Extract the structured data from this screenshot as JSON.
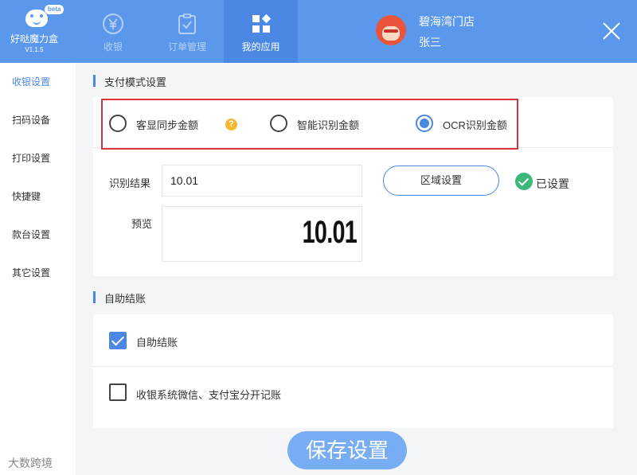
{
  "app": {
    "badge": "beta",
    "name": "好哒魔力盒",
    "version": "V1.1.5"
  },
  "nav": [
    {
      "label": "收银",
      "icon": "yen-icon"
    },
    {
      "label": "订单管理",
      "icon": "clipboard-check-icon"
    },
    {
      "label": "我的应用",
      "icon": "apps-grid-icon"
    }
  ],
  "store": {
    "name": "碧海湾门店",
    "user": "张三"
  },
  "sidebar": {
    "items": [
      {
        "label": "收银设置"
      },
      {
        "label": "扫码设备"
      },
      {
        "label": "打印设置"
      },
      {
        "label": "快捷键"
      },
      {
        "label": "款台设置"
      },
      {
        "label": "其它设置"
      }
    ]
  },
  "payment_mode": {
    "title": "支付模式设置",
    "options": [
      {
        "label": "客显同步金额",
        "checked": false
      },
      {
        "label": "智能识别金额",
        "checked": false
      },
      {
        "label": "OCR识别金额",
        "checked": true
      }
    ],
    "result_label": "识别结果",
    "result_value": "10.01",
    "area_button": "区域设置",
    "set_status": "已设置",
    "preview_label": "预览",
    "preview_value": "10.01"
  },
  "self_checkout": {
    "title": "自助结账",
    "options": [
      {
        "label": "自助结账",
        "checked": true
      },
      {
        "label": "收银系统微信、支付宝分开记账",
        "checked": false
      }
    ]
  },
  "save_button": "保存设置",
  "watermark": "大数跨境",
  "colors": {
    "header": "#5b98ec",
    "accent": "#4a88e4",
    "highlight_border": "#d9333c",
    "success": "#3cb878",
    "warning": "#f5b82e"
  }
}
